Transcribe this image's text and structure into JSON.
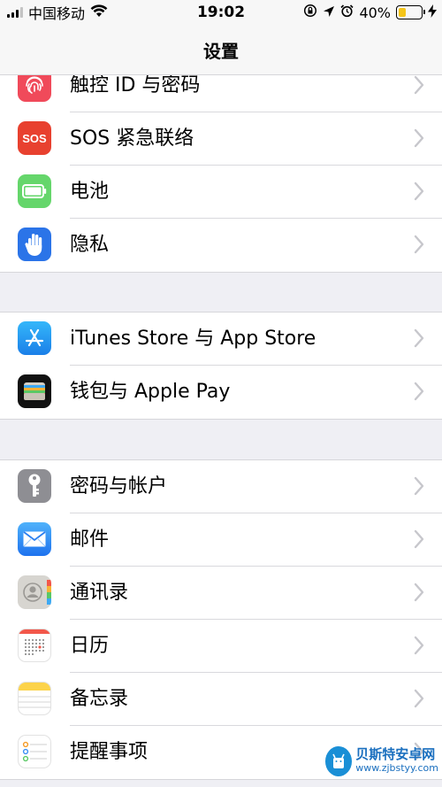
{
  "status_bar": {
    "carrier": "中国移动",
    "time": "19:02",
    "battery_percent": "40%",
    "battery_level": 0.4
  },
  "nav": {
    "title": "设置"
  },
  "groups": [
    {
      "items": [
        {
          "label": "触控 ID 与密码",
          "icon": "fingerprint-icon",
          "color": "#f04a5a"
        },
        {
          "label": "SOS 紧急联络",
          "icon": "sos-icon",
          "color": "#e8412f",
          "icon_text": "SOS"
        },
        {
          "label": "电池",
          "icon": "battery-icon",
          "color": "#65d66b"
        },
        {
          "label": "隐私",
          "icon": "hand-icon",
          "color": "#2b74e8"
        }
      ]
    },
    {
      "items": [
        {
          "label": "iTunes Store 与 App Store",
          "icon": "app-store-icon",
          "color": "#1e9af0"
        },
        {
          "label": "钱包与 Apple Pay",
          "icon": "wallet-icon",
          "color": "#111111"
        }
      ]
    },
    {
      "items": [
        {
          "label": "密码与帐户",
          "icon": "key-icon",
          "color": "#8e8e93"
        },
        {
          "label": "邮件",
          "icon": "mail-icon",
          "color": "#3a8ef5"
        },
        {
          "label": "通讯录",
          "icon": "contacts-icon",
          "color": "#d8d8d8"
        },
        {
          "label": "日历",
          "icon": "calendar-icon",
          "color": "#ffffff"
        },
        {
          "label": "备忘录",
          "icon": "notes-icon",
          "color": "#ffffff"
        },
        {
          "label": "提醒事项",
          "icon": "reminders-icon",
          "color": "#ffffff"
        }
      ]
    }
  ],
  "watermark": {
    "title": "贝斯特安卓网",
    "url": "www.zjbstyy.com"
  }
}
